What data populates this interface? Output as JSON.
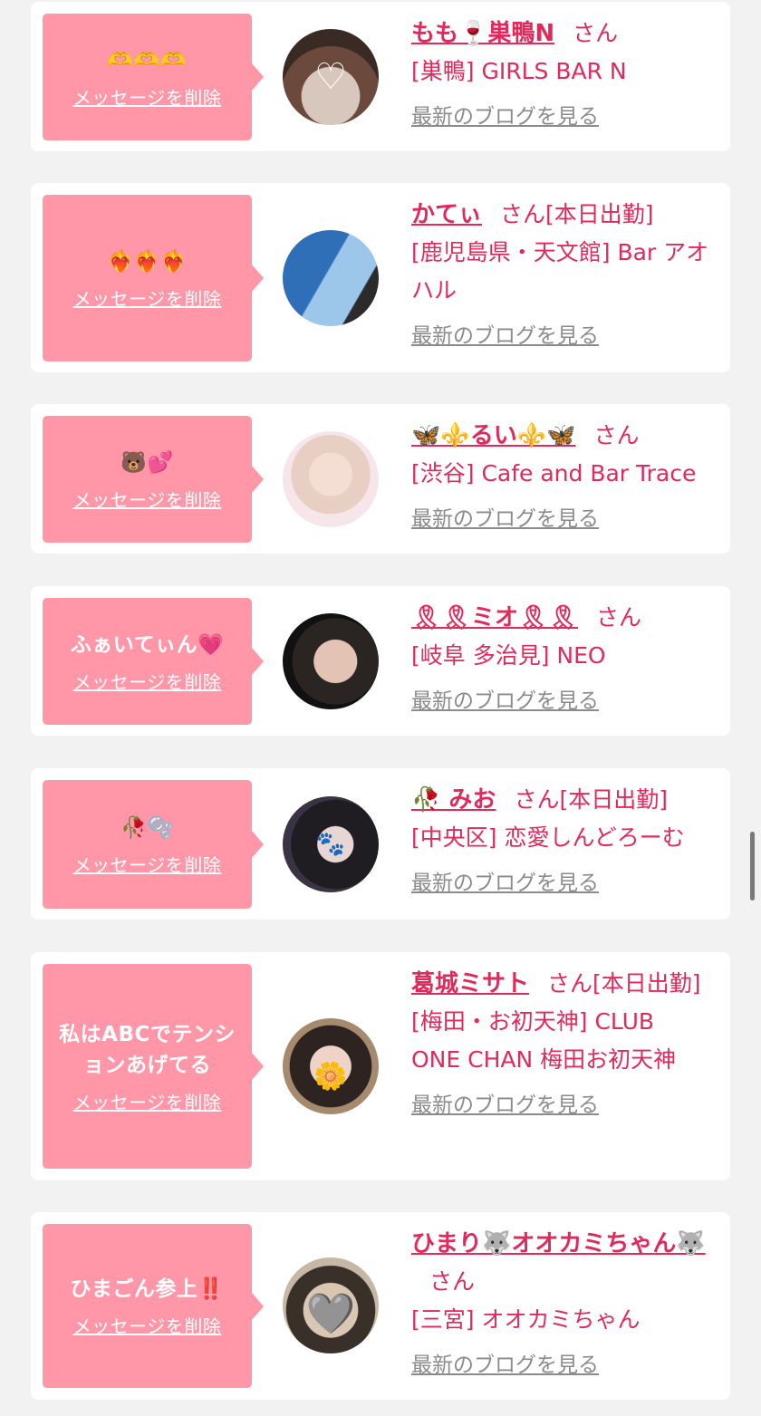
{
  "delete_label": "メッセージを削除",
  "blog_label": "最新のブログを見る",
  "san_label": "さん",
  "entries": [
    {
      "message": "🫶🫶🫶",
      "name": "もも🍷巣鴨N",
      "status": "",
      "shop": "[巣鴨] GIRLS BAR N",
      "avatar_icon": "white-heart-icon",
      "avatar_glyph": "♡"
    },
    {
      "message": "❤️‍🔥❤️‍🔥❤️‍🔥",
      "name": "かてぃ",
      "status": "[本日出勤]",
      "shop": "[鹿児島県・天文館] Bar アオハル",
      "avatar_icon": "",
      "avatar_glyph": ""
    },
    {
      "message": "🐻💕",
      "name": "🦋⚜️るい⚜️🦋",
      "status": "",
      "shop": "[渋谷] Cafe and Bar Trace",
      "avatar_icon": "",
      "avatar_glyph": ""
    },
    {
      "message": "ふぁいてぃん💗",
      "name": "🎗🎗ミオ🎗🎗",
      "status": "",
      "shop": "[岐阜 多治見] NEO",
      "avatar_icon": "",
      "avatar_glyph": ""
    },
    {
      "message": "🥀🫧",
      "name": "🥀 みお",
      "status": "[本日出勤]",
      "shop": "[中央区] 恋愛しんどろーむ",
      "avatar_icon": "paw-icon",
      "avatar_glyph": "🐾"
    },
    {
      "message": "私はABCでテンションあげてる",
      "name": "葛城ミサト",
      "status": "[本日出勤]",
      "shop": "[梅田・お初天神] CLUB ONE CHAN 梅田お初天神",
      "avatar_icon": "flower-icon",
      "avatar_glyph": "🌼"
    },
    {
      "message": "ひまごん参上‼️",
      "name": "ひまり🐺オオカミちゃん🐺",
      "status": "",
      "shop": "[三宮] オオカミちゃん",
      "avatar_icon": "grey-heart-icon",
      "avatar_glyph": "🩶"
    }
  ],
  "colors": {
    "accent": "#e02a5c",
    "bubble": "#ff97a8",
    "link_grey": "#8b8b8b",
    "background": "#f2f2f2"
  }
}
